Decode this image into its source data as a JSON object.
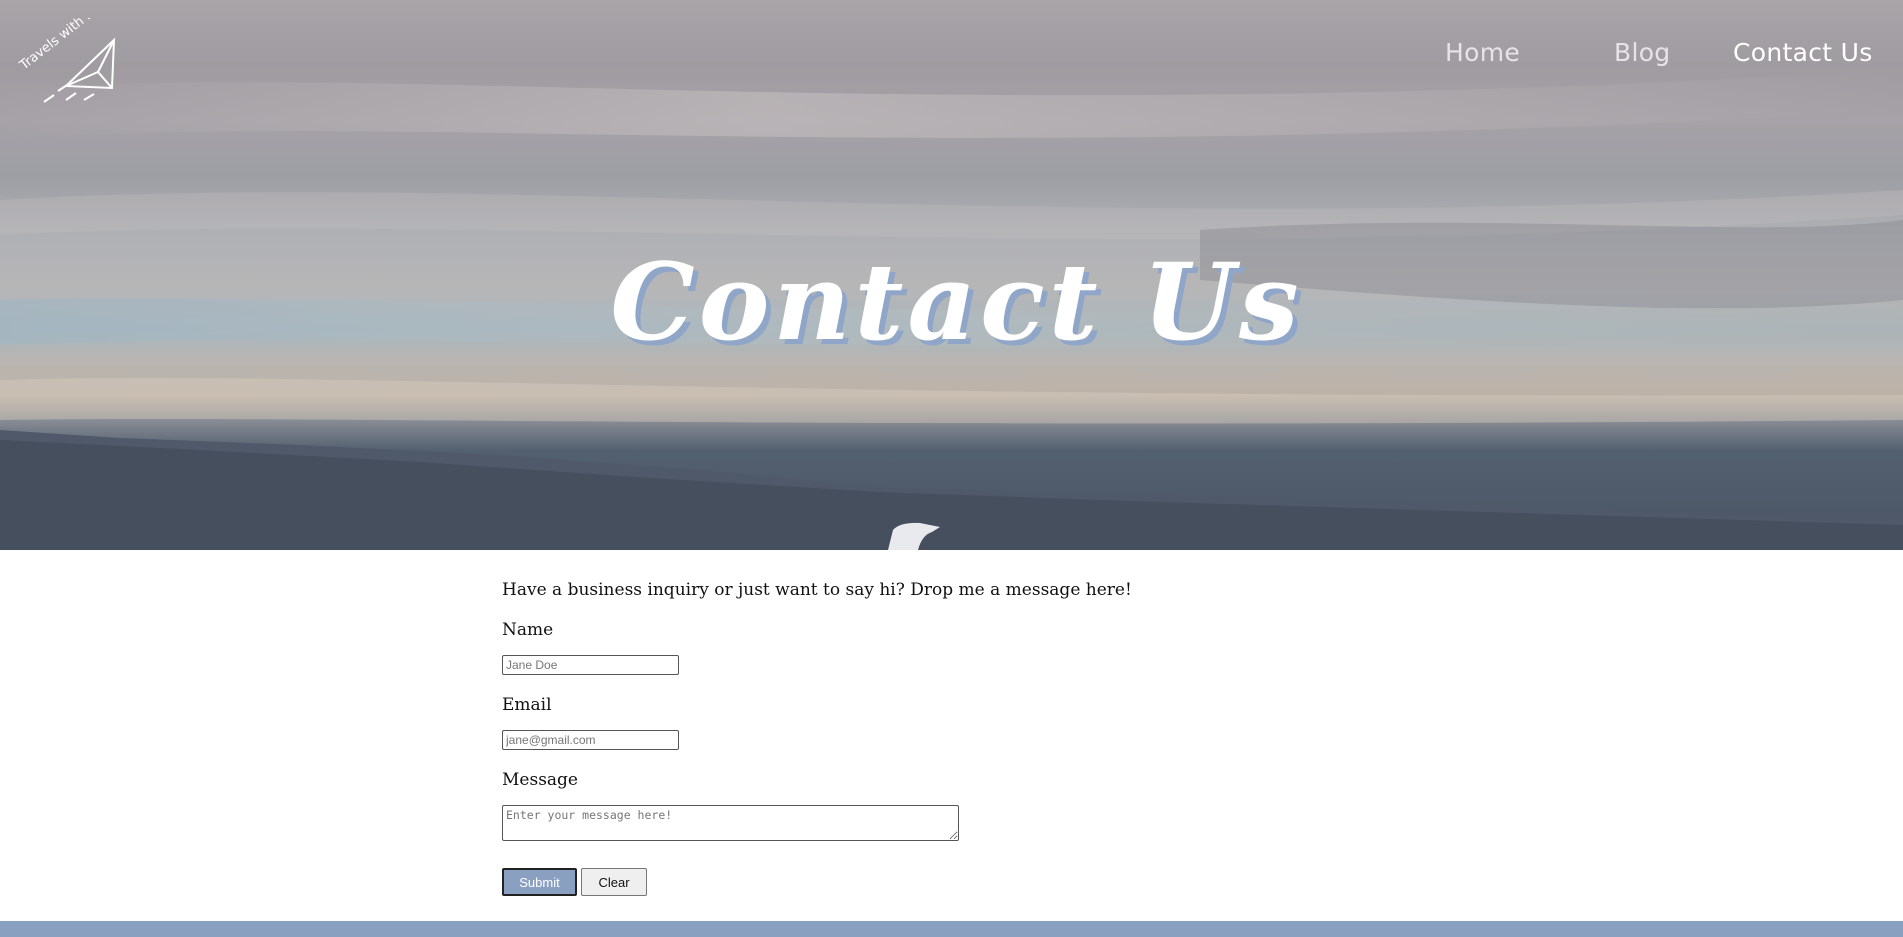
{
  "nav": {
    "home": "Home",
    "blog": "Blog",
    "contact": "Contact Us",
    "active": "Contact Us"
  },
  "logo": {
    "text": "Travels with Sky",
    "icon": "paper-plane-icon"
  },
  "hero": {
    "title": "Contact Us"
  },
  "form": {
    "intro": "Have a business inquiry or just want to say hi? Drop me a message here!",
    "name_label": "Name",
    "name_placeholder": "Jane Doe",
    "name_value": "",
    "email_label": "Email",
    "email_placeholder": "jane@gmail.com",
    "email_value": "",
    "message_label": "Message",
    "message_placeholder": "Enter your message here!",
    "message_value": "",
    "submit_label": "Submit",
    "clear_label": "Clear"
  },
  "colors": {
    "accent": "#8aa0c1",
    "title_shadow": "#8fa6c8",
    "nav_text": "#e6e4e6",
    "nav_active": "#ffffff"
  }
}
